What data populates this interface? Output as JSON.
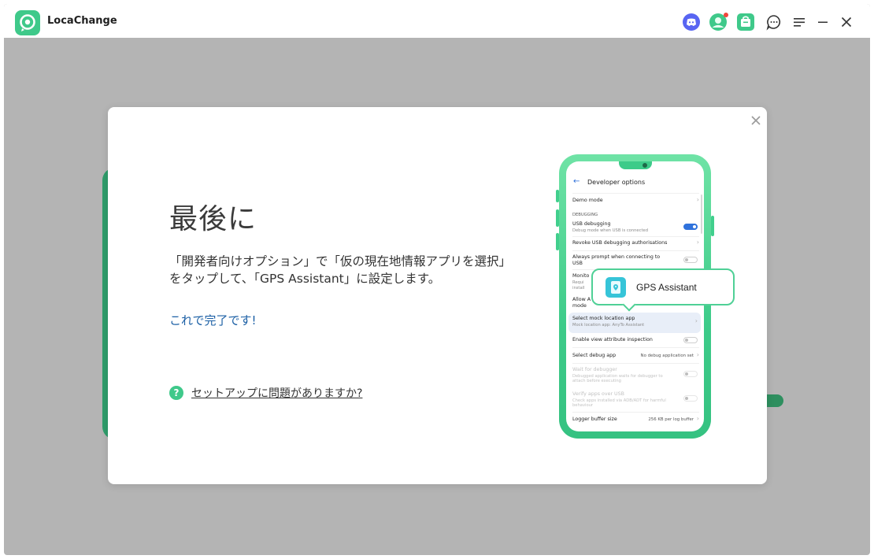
{
  "app": {
    "title": "LocaChange"
  },
  "titlebar": {
    "icons": [
      "discord-icon",
      "user-avatar-icon",
      "shop-bag-icon",
      "chat-feedback-icon",
      "menu-icon",
      "minimize-icon",
      "close-icon"
    ],
    "brand_color": "#3fc98a"
  },
  "modal": {
    "heading": "最後に",
    "description": "「開発者向けオプション」で「仮の現在地情報アプリを選択」をタップして、「GPS Assistant」に設定します。",
    "done_text": "これで完了です!",
    "help_link": "セットアップに問題がありますか?",
    "help_icon_glyph": "?"
  },
  "phone": {
    "header_title": "Developer options",
    "rows": {
      "demo_mode": "Demo mode",
      "section_debugging": "DEBUGGING",
      "usb_debugging": "USB debugging",
      "usb_debugging_sub": "Debug mode when USB is connected",
      "revoke": "Revoke USB debugging authorisations",
      "always_prompt": "Always prompt when connecting to",
      "always_prompt_2": "USB",
      "monitor": "Monito",
      "monitor_sub1": "Requi",
      "monitor_sub2": "install",
      "allow": "Allow A",
      "allow_2": "mode",
      "select_mock": "Select mock location app",
      "select_mock_sub": "Mock location app: AnyTo Assistant",
      "view_attr": "Enable view attribute inspection",
      "debug_app": "Select debug app",
      "debug_app_value": "No debug application set",
      "wait_debugger": "Wait for debugger",
      "wait_debugger_sub1": "Debugged application waits for debugger to",
      "wait_debugger_sub2": "attach before executing",
      "verify_apps": "Verify apps over USB",
      "verify_apps_sub1": "Check apps installed via ADB/ADT for harmful",
      "verify_apps_sub2": "behaviour",
      "logger": "Logger buffer size",
      "logger_value": "256 KB per log buffer"
    },
    "usb_debugging_on": true
  },
  "popup": {
    "label": "GPS Assistant"
  }
}
